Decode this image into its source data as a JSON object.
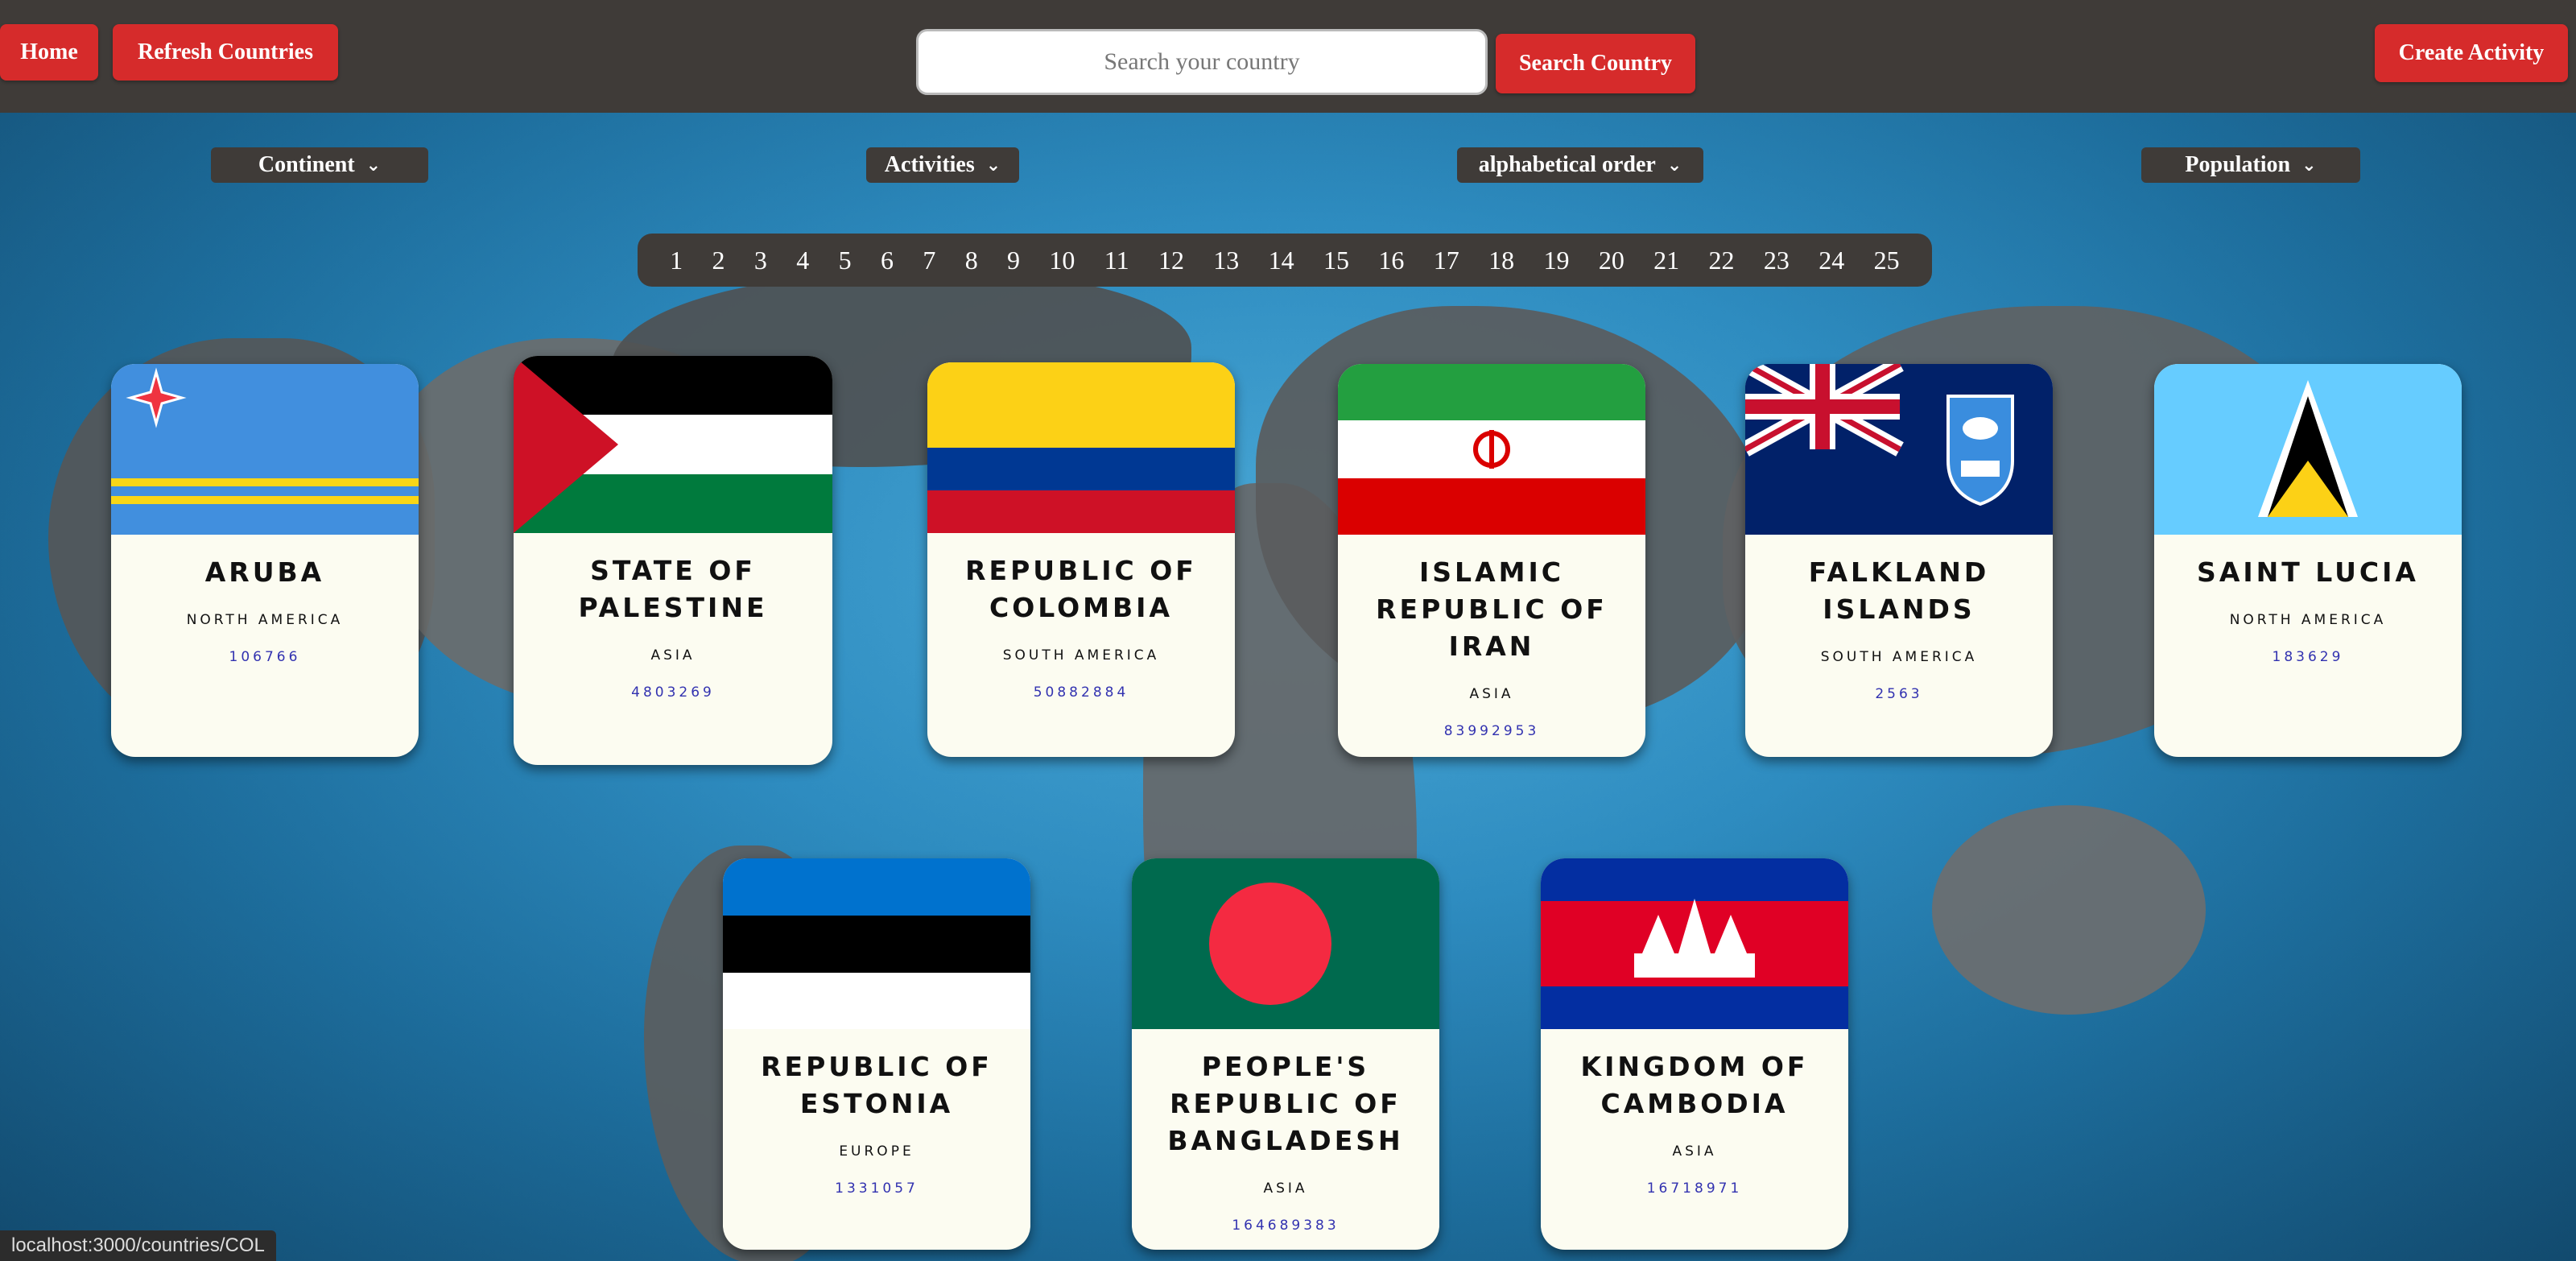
{
  "header": {
    "home_label": "Home",
    "refresh_label": "Refresh Countries",
    "search_placeholder": "Search your country",
    "search_button_label": "Search Country",
    "create_activity_label": "Create Activity"
  },
  "filters": {
    "continent": "Continent",
    "activities": "Activities",
    "order": "alphabetical order",
    "population": "Population"
  },
  "pagination": [
    "1",
    "2",
    "3",
    "4",
    "5",
    "6",
    "7",
    "8",
    "9",
    "10",
    "11",
    "12",
    "13",
    "14",
    "15",
    "16",
    "17",
    "18",
    "19",
    "20",
    "21",
    "22",
    "23",
    "24",
    "25"
  ],
  "cards": [
    {
      "name": "ARUBA",
      "continent": "NORTH AMERICA",
      "population": "106766",
      "flag": "aruba"
    },
    {
      "name": "STATE OF PALESTINE",
      "continent": "ASIA",
      "population": "4803269",
      "flag": "palestine"
    },
    {
      "name": "REPUBLIC OF COLOMBIA",
      "continent": "SOUTH AMERICA",
      "population": "50882884",
      "flag": "colombia"
    },
    {
      "name": "ISLAMIC REPUBLIC OF IRAN",
      "continent": "ASIA",
      "population": "83992953",
      "flag": "iran"
    },
    {
      "name": "FALKLAND ISLANDS",
      "continent": "SOUTH AMERICA",
      "population": "2563",
      "flag": "falkland"
    },
    {
      "name": "SAINT LUCIA",
      "continent": "NORTH AMERICA",
      "population": "183629",
      "flag": "saint-lucia"
    },
    {
      "name": "REPUBLIC OF ESTONIA",
      "continent": "EUROPE",
      "population": "1331057",
      "flag": "estonia"
    },
    {
      "name": "PEOPLE'S REPUBLIC OF BANGLADESH",
      "continent": "ASIA",
      "population": "164689383",
      "flag": "bangladesh"
    },
    {
      "name": "KINGDOM OF CAMBODIA",
      "continent": "ASIA",
      "population": "16718971",
      "flag": "cambodia"
    }
  ],
  "status_bar": {
    "url": "localhost:3000/countries/COL"
  },
  "colors": {
    "accent_red": "#d62b2b",
    "header_bg": "#3f3b38",
    "card_bg": "#fcfcf1"
  }
}
